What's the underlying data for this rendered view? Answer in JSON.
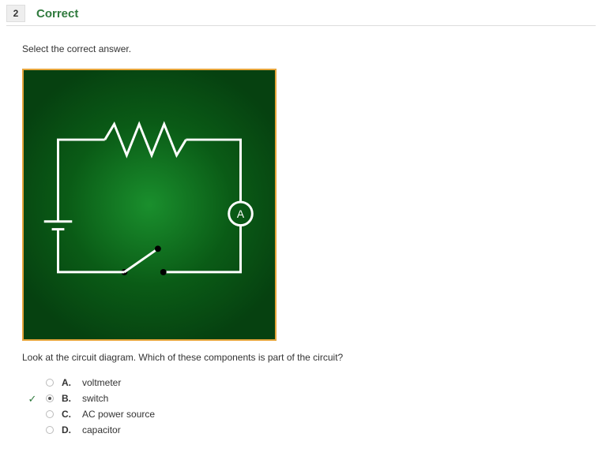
{
  "header": {
    "question_number": "2",
    "status_label": "Correct"
  },
  "instruction": "Select the correct answer.",
  "diagram": {
    "ammeter_label": "A",
    "components_present": [
      "battery",
      "resistor",
      "ammeter",
      "switch"
    ]
  },
  "question_text": "Look at the circuit diagram. Which of these components is part of the circuit?",
  "answers": [
    {
      "letter": "A.",
      "text": "voltmeter",
      "selected": false,
      "correct": false
    },
    {
      "letter": "B.",
      "text": "switch",
      "selected": true,
      "correct": true
    },
    {
      "letter": "C.",
      "text": "AC power source",
      "selected": false,
      "correct": false
    },
    {
      "letter": "D.",
      "text": "capacitor",
      "selected": false,
      "correct": false
    }
  ]
}
